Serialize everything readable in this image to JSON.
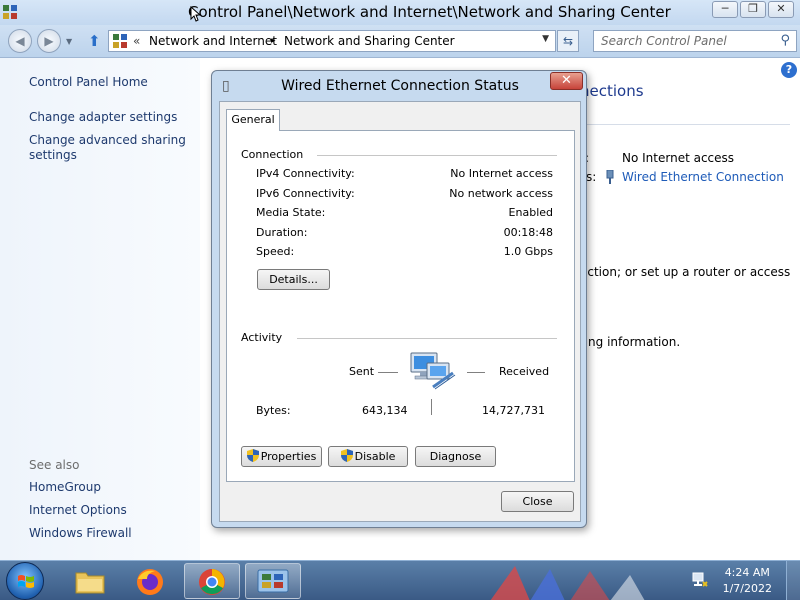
{
  "window": {
    "title": "Control Panel\\Network and Internet\\Network and Sharing Center",
    "minimize": "─",
    "maximize": "❐",
    "close": "✕"
  },
  "address": {
    "back": "◀",
    "forward": "▶",
    "overflow": "«",
    "crumbs": [
      "Network and Internet",
      "Network and Sharing Center"
    ],
    "separator": "▸",
    "search_placeholder": "Search Control Panel"
  },
  "sidebar": {
    "items": [
      {
        "label": "Control Panel Home"
      },
      {
        "label": "Change adapter settings"
      },
      {
        "label": "Change advanced sharing settings"
      }
    ],
    "see_also_label": "See also",
    "see_also": [
      {
        "label": "HomeGroup"
      },
      {
        "label": "Internet Options"
      },
      {
        "label": "Windows Firewall"
      }
    ]
  },
  "background": {
    "heading_fragment": "nections",
    "access_type_fragment": ":",
    "access_type_value": "No Internet access",
    "connections_fragment": "s:",
    "connection_link": "Wired Ethernet Connection",
    "setup_fragment": "ection; or set up a router or access",
    "info_fragment": "ting information.",
    "help": "?"
  },
  "dialog": {
    "title": "Wired Ethernet Connection Status",
    "close": "✕",
    "tab": "General",
    "connection": {
      "title": "Connection",
      "rows": [
        {
          "label": "IPv4 Connectivity:",
          "value": "No Internet access"
        },
        {
          "label": "IPv6 Connectivity:",
          "value": "No network access"
        },
        {
          "label": "Media State:",
          "value": "Enabled"
        },
        {
          "label": "Duration:",
          "value": "00:18:48"
        },
        {
          "label": "Speed:",
          "value": "1.0 Gbps"
        }
      ],
      "details_button": "Details..."
    },
    "activity": {
      "title": "Activity",
      "sent_label": "Sent",
      "received_label": "Received",
      "bytes_label": "Bytes:",
      "bytes_sent": "643,134",
      "bytes_received": "14,727,731"
    },
    "buttons": {
      "properties": "Properties",
      "disable": "Disable",
      "diagnose": "Diagnose",
      "close": "Close"
    }
  },
  "taskbar": {
    "time": "4:24 AM",
    "date": "1/7/2022"
  },
  "colors": {
    "link": "#1e3a6e",
    "heading_blue": "#1e3a8e",
    "taskbar": "#3a5a85"
  }
}
